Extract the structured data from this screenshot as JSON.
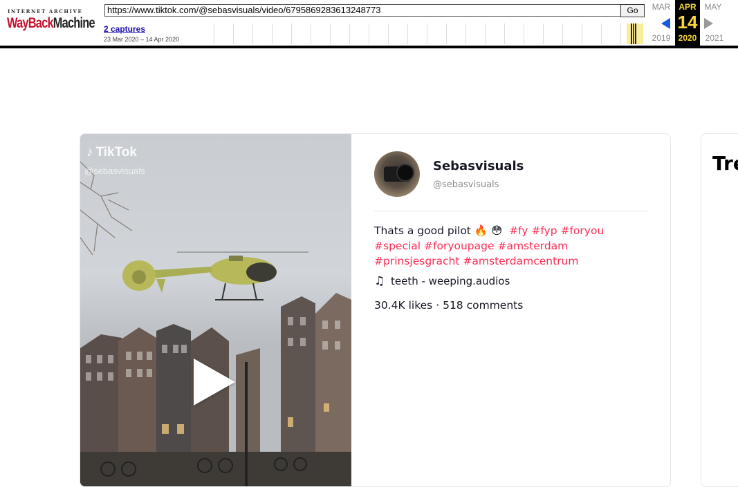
{
  "wayback": {
    "ia_text": "INTERNET ARCHIVE",
    "logo_wayback": "WayBack",
    "logo_machine": "Machine",
    "url": "https://www.tiktok.com/@sebasvisuals/video/6795869283613248773",
    "go_label": "Go",
    "captures_label": "2 captures",
    "capture_range": "23 Mar 2020 – 14 Apr 2020",
    "prev_month": "MAR",
    "cur_month": "APR",
    "next_month": "MAY",
    "cur_day": "14",
    "prev_year": "2019",
    "cur_year": "2020",
    "next_year": "2021",
    "accent": "#f9d838"
  },
  "video": {
    "watermark_brand": "TikTok",
    "watermark_handle": "@sebasvisuals",
    "play_icon": "play-icon"
  },
  "post": {
    "display_name": "Sebasvisuals",
    "handle": "@sebasvisuals",
    "caption_text": "Thats a good pilot 🔥 😳",
    "hashtags": [
      "#fy",
      "#fyp",
      "#foryou",
      "#special",
      "#foryoupage",
      "#amsterdam",
      "#prinsjesgracht",
      "#amsterdamcentrum"
    ],
    "music": "teeth - weeping.audios",
    "likes": "30.4K likes",
    "comments": "518 comments",
    "separator": "·",
    "hashtag_color": "#fe2c55"
  },
  "side": {
    "title_fragment": "Tre"
  }
}
